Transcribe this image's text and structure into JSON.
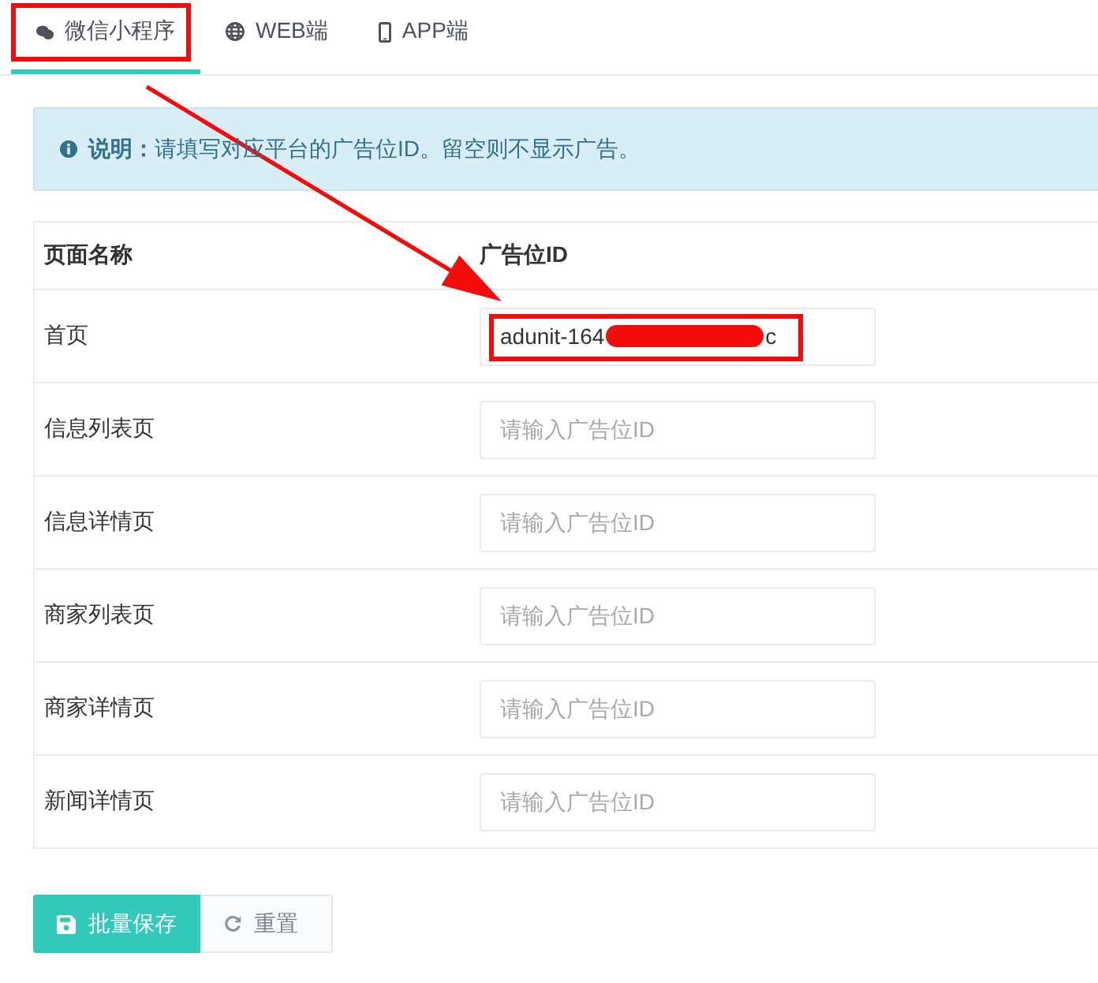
{
  "tabs": [
    {
      "label": "微信小程序",
      "kind": "miniprogram",
      "selected": true,
      "highlighted": true
    },
    {
      "label": "WEB端",
      "kind": "web",
      "selected": false,
      "highlighted": false
    },
    {
      "label": "APP端",
      "kind": "app",
      "selected": false,
      "highlighted": false
    }
  ],
  "notice": {
    "text": "**说明：**请填写对应平台的广告位ID。留空则不显示广告。"
  },
  "table": {
    "columns": [
      "页面名称",
      "广告位ID"
    ],
    "rows": [
      {
        "page": "首页",
        "field": {
          "value": "adunit-164",
          "value_end": "c",
          "redacted": true,
          "highlighted": true
        }
      },
      {
        "page": "信息列表页",
        "field": {
          "placeholder": "请输入广告位ID",
          "highlighted": false
        }
      },
      {
        "page": "信息详情页",
        "field": {
          "placeholder": "请输入广告位ID",
          "highlighted": false
        }
      },
      {
        "page": "商家列表页",
        "field": {
          "placeholder": "请输入广告位ID",
          "highlighted": false
        }
      },
      {
        "page": "商家详情页",
        "field": {
          "placeholder": "请输入广告位ID",
          "highlighted": false
        }
      },
      {
        "page": "新闻详情页",
        "field": {
          "placeholder": "请输入广告位ID",
          "highlighted": false
        }
      }
    ]
  },
  "buttons": [
    {
      "label": "批量保存",
      "kind": "primary"
    },
    {
      "label": "重置",
      "kind": "default"
    }
  ],
  "annotation": {
    "arrow": true
  }
}
